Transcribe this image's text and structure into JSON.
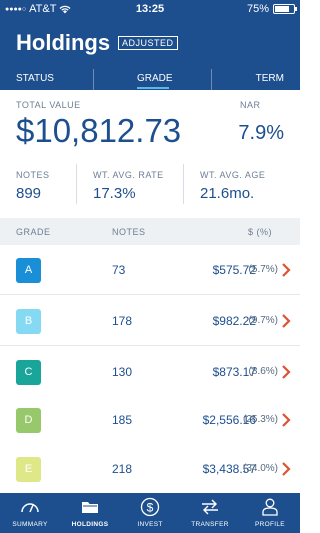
{
  "status_bar": {
    "carrier": "AT&T",
    "time": "13:25",
    "battery": "75%"
  },
  "header": {
    "title": "Holdings",
    "badge": "ADJUSTED"
  },
  "tabs": [
    {
      "label": "STATUS",
      "active": false
    },
    {
      "label": "GRADE",
      "active": true
    },
    {
      "label": "TERM",
      "active": false
    }
  ],
  "summary": {
    "total_label": "TOTAL VALUE",
    "total_value": "$10,812.73",
    "nar_label": "NAR",
    "nar_value": "7.9%",
    "stats": [
      {
        "label": "NOTES",
        "value": "899"
      },
      {
        "label": "WT. AVG. RATE",
        "value": "17.3%"
      },
      {
        "label": "WT. AVG. AGE",
        "value": "21.6mo."
      }
    ]
  },
  "list_header": {
    "grade": "GRADE",
    "notes": "NOTES",
    "amount": "$ (%)"
  },
  "rows": [
    {
      "grade": "A",
      "notes": "73",
      "amount": "$575.72",
      "pct": "(5.7%)",
      "color": "#1a8fd8"
    },
    {
      "grade": "B",
      "notes": "178",
      "amount": "$982.22",
      "pct": "(9.7%)",
      "color": "#86d9f2"
    },
    {
      "grade": "C",
      "notes": "130",
      "amount": "$873.17",
      "pct": "(8.6%)",
      "color": "#1aa59a"
    },
    {
      "grade": "D",
      "notes": "185",
      "amount": "$2,556.16",
      "pct": "(25.3%)",
      "color": "#97c86c"
    },
    {
      "grade": "E",
      "notes": "218",
      "amount": "$3,438.57",
      "pct": "(34.0%)",
      "color": "#dfe889"
    }
  ],
  "nav": [
    {
      "label": "SUMMARY",
      "icon": "gauge-icon",
      "active": false
    },
    {
      "label": "HOLDINGS",
      "icon": "folder-icon",
      "active": true
    },
    {
      "label": "INVEST",
      "icon": "dollar-circle-icon",
      "active": false
    },
    {
      "label": "TRANSFER",
      "icon": "transfer-arrows-icon",
      "active": false
    },
    {
      "label": "PROFILE",
      "icon": "person-icon",
      "active": false
    }
  ],
  "colors": {
    "brand": "#1d4f8e",
    "accent_underline": "#5db8e8",
    "chevron": "#e0522e"
  }
}
